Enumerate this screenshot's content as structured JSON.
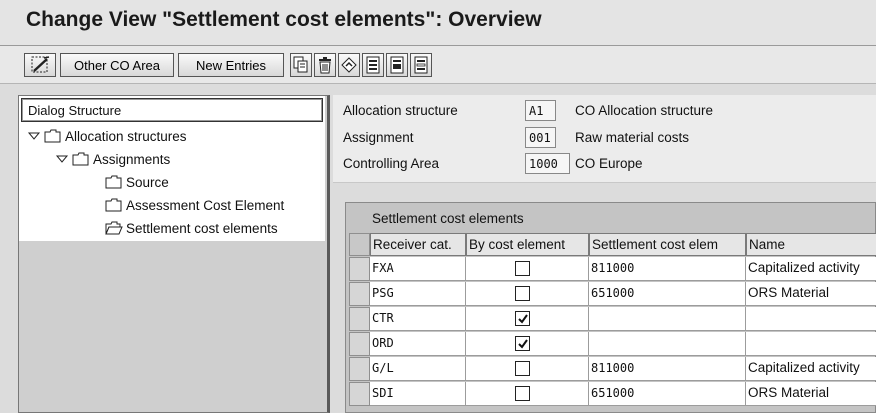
{
  "window": {
    "title": "Change View \"Settlement cost elements\": Overview"
  },
  "toolbar": {
    "toggle_icon": "display-change-icon",
    "other_co_area_label": "Other CO Area",
    "new_entries_label": "New Entries",
    "icons": [
      "copy-icon",
      "delete-icon",
      "undo-change-icon",
      "select-all-icon",
      "select-block-icon",
      "deselect-all-icon"
    ]
  },
  "dialog_structure": {
    "header": "Dialog Structure",
    "nodes": [
      {
        "label": "Allocation structures",
        "icon": "folder-icon",
        "expanded": true
      },
      {
        "label": "Assignments",
        "icon": "folder-icon",
        "expanded": true
      },
      {
        "label": "Source",
        "icon": "folder-icon"
      },
      {
        "label": "Assessment Cost Element",
        "icon": "folder-icon"
      },
      {
        "label": "Settlement cost elements",
        "icon": "folder-open-icon",
        "selected": true
      }
    ]
  },
  "header_fields": [
    {
      "label": "Allocation structure",
      "value": "A1",
      "description": "CO Allocation structure"
    },
    {
      "label": "Assignment",
      "value": "001",
      "description": "Raw material costs"
    },
    {
      "label": "Controlling Area",
      "value": "1000",
      "description": "CO Europe"
    }
  ],
  "table": {
    "title": "Settlement cost elements",
    "columns": [
      "Receiver cat.",
      "By cost element",
      "Settlement cost elem",
      "Name"
    ],
    "rows": [
      {
        "receiver": "FXA",
        "by_cost_element": false,
        "cost_element": "811000",
        "name": "Capitalized activity"
      },
      {
        "receiver": "PSG",
        "by_cost_element": false,
        "cost_element": "651000",
        "name": "ORS Material"
      },
      {
        "receiver": "CTR",
        "by_cost_element": true,
        "cost_element": "",
        "name": ""
      },
      {
        "receiver": "ORD",
        "by_cost_element": true,
        "cost_element": "",
        "name": ""
      },
      {
        "receiver": "G/L",
        "by_cost_element": false,
        "cost_element": "811000",
        "name": "Capitalized activity"
      },
      {
        "receiver": "SDI",
        "by_cost_element": false,
        "cost_element": "651000",
        "name": "ORS Material"
      }
    ]
  }
}
